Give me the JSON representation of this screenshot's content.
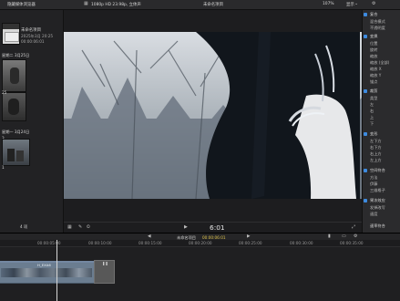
{
  "topbar": {
    "left_title": "隐藏媒体浏览器",
    "format": "1080p HD 23.98p, 立体声",
    "project_title": "未命名项目",
    "zoom": "107%",
    "view": "显示"
  },
  "sidebar": {
    "event_title": "未命名项目",
    "event_date": "2025年3月 20:25",
    "event_duration": "00:00:06:01",
    "date_group_1": "星期二 3月25日",
    "date_group_2": "星期一 3月24日",
    "count_1": "2",
    "count_2": "3",
    "count_3": "1",
    "badge_1": "25",
    "footer_count": "4 项"
  },
  "viewer": {
    "timecode": "6:01"
  },
  "inspector": {
    "sections": [
      {
        "title": "复合",
        "items": [
          "混合模式",
          "不透明度"
        ]
      },
      {
        "title": "变换",
        "items": [
          "位置",
          "旋转",
          "缩放",
          "缩放 (全部)",
          "缩放 X",
          "缩放 Y",
          "锚点"
        ]
      },
      {
        "title": "裁剪",
        "items": [
          "类型",
          "左",
          "右",
          "上",
          "下"
        ]
      },
      {
        "title": "变形",
        "items": [
          "左下方",
          "右下方",
          "右上方",
          "左上方"
        ]
      },
      {
        "title": "空间符合",
        "items": [
          "方法",
          "伊藤",
          "三维格子"
        ]
      },
      {
        "title": "果冻效应",
        "items": [
          "发掉改写",
          "速度"
        ]
      },
      {
        "title": "",
        "items": [
          "速率符合"
        ]
      }
    ]
  },
  "timeline": {
    "project_title": "未命名项目",
    "duration": "00:00:06:01",
    "ruler_marks": [
      "00:00:05:00",
      "00:00:10:00",
      "00:00:15:00",
      "00:00:20:00",
      "00:00:25:00",
      "00:00:30:00",
      "00:00:35:00"
    ],
    "clip_label": "H_EXA6"
  },
  "colors": {
    "accent": "#3d8be0",
    "clip": "#6b7d90"
  }
}
